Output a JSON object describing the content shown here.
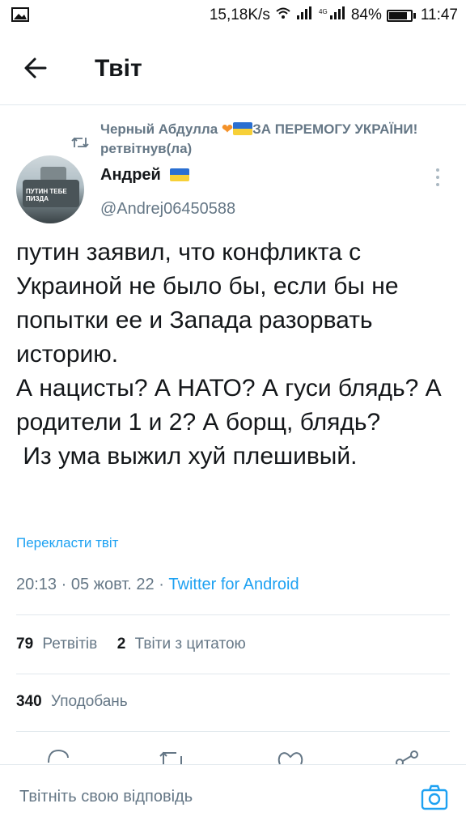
{
  "status_bar": {
    "network_speed": "15,18K/s",
    "battery": "84%",
    "time": "11:47"
  },
  "header": {
    "title": "Твіт"
  },
  "retweet_context": {
    "text_part1": "Черный Абдулла ",
    "text_part2": "ЗА ПЕРЕМОГУ УКРАЇНИ! ретвітнув(ла)"
  },
  "author": {
    "name": "Андрей",
    "handle": "@Andrej06450588",
    "avatar_text": "ПУТИН ТЕБЕ ПИЗДА"
  },
  "tweet": {
    "text": "путин заявил, что конфликта с Украиной не было бы, если бы не попытки ее и Запада разорвать историю.\nА нацисты? А НАТО? А гуси блядь? А родители 1 и 2? А борщ, блядь?\n Из ума выжил хуй плешивый.",
    "translate_label": "Перекласти твіт",
    "time": "20:13",
    "date": "05 жовт. 22",
    "source": "Twitter for Android"
  },
  "stats": {
    "retweets_count": "79",
    "retweets_label": "Ретвітів",
    "quotes_count": "2",
    "quotes_label": "Твіти з цитатою",
    "likes_count": "340",
    "likes_label": "Уподобань"
  },
  "reply": {
    "placeholder": "Твітніть свою відповідь"
  },
  "icons": [
    "back-arrow-icon",
    "retweet-icon",
    "more-vertical-icon",
    "reply-icon",
    "like-icon",
    "share-icon",
    "camera-icon"
  ],
  "colors": {
    "link": "#1da1f2",
    "secondary_text": "#657786",
    "heart": "#f4922a"
  }
}
